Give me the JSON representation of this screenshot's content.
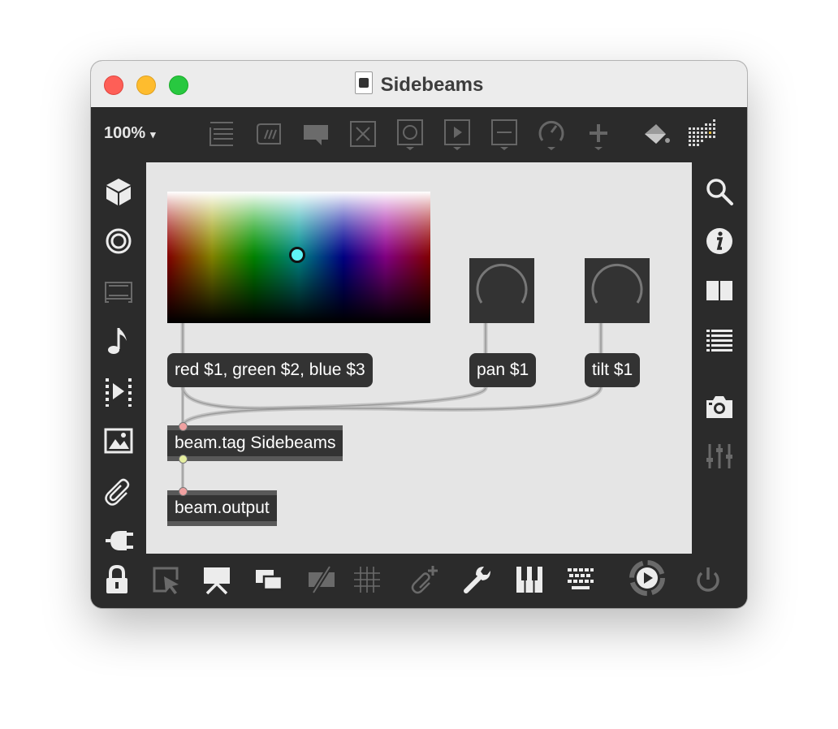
{
  "window": {
    "title": "Sidebeams"
  },
  "toolbar": {
    "zoom": "100%",
    "zoom_caret": "▾",
    "items": [
      "comment-box-icon",
      "message-icon",
      "comment-bubble-icon",
      "toggle-icon",
      "button-icon",
      "play-button-icon",
      "number-box-icon",
      "dial-icon",
      "plus-icon",
      "paint-bucket-icon",
      "grid-palette-icon"
    ]
  },
  "left_sidebar": [
    "cube-icon",
    "target-icon",
    "display-icon",
    "music-note-icon",
    "play-step-icon",
    "image-icon",
    "paperclip-icon",
    "plug-icon"
  ],
  "right_sidebar": [
    "search-icon",
    "info-icon",
    "book-icon",
    "list-icon",
    "camera-icon",
    "mixer-icon"
  ],
  "bottombar": [
    "lock-icon",
    "select-cursor-icon",
    "presentation-icon",
    "windows-icon",
    "hide-icon",
    "grid-icon",
    "add-attachment-icon",
    "wrench-icon",
    "piano-icon",
    "keyboard-icon",
    "transport-icon",
    "power-icon"
  ],
  "patch": {
    "color_message": "red $1, green $2, blue $3",
    "pan_message": "pan $1",
    "tilt_message": "tilt $1",
    "tag_object": "beam.tag Sidebeams",
    "output_object": "beam.output"
  },
  "colors": {
    "canvas": "#e5e5e5",
    "object": "#333333",
    "chrome": "#2b2b2b",
    "cursor": "#5ff3f5"
  }
}
